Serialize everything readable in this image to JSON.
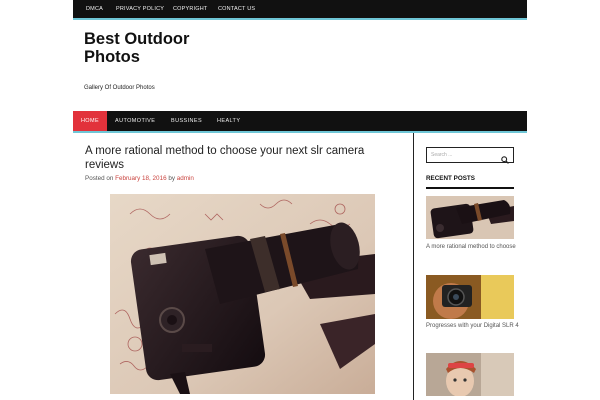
{
  "topnav": {
    "items": [
      "DMCA",
      "PRIVACY POLICY",
      "COPYRIGHT",
      "CONTACT US"
    ]
  },
  "header": {
    "title": "Best Outdoor Photos",
    "tagline": "Gallery Of Outdoor Photos"
  },
  "mainnav": {
    "items": [
      "HOME",
      "AUTOMOTIVE",
      "BUSSINES",
      "HEALTY"
    ],
    "active": "HOME"
  },
  "post": {
    "title": "A more rational method to choose your next slr camera reviews",
    "meta_prefix": "Posted on",
    "date": "February 18, 2016",
    "meta_by": "by",
    "author": "admin"
  },
  "sidebar": {
    "search_placeholder": "Search ...",
    "recent_title": "RECENT POSTS",
    "recent": [
      "A more rational method to choose",
      "Progresses with your Digital SLR 4"
    ]
  },
  "colors": {
    "nav_bg": "#111111",
    "accent_border": "#6fc6d6",
    "active_nav": "#e2323b",
    "link": "#c9433e"
  },
  "icons": [
    "search-icon"
  ]
}
